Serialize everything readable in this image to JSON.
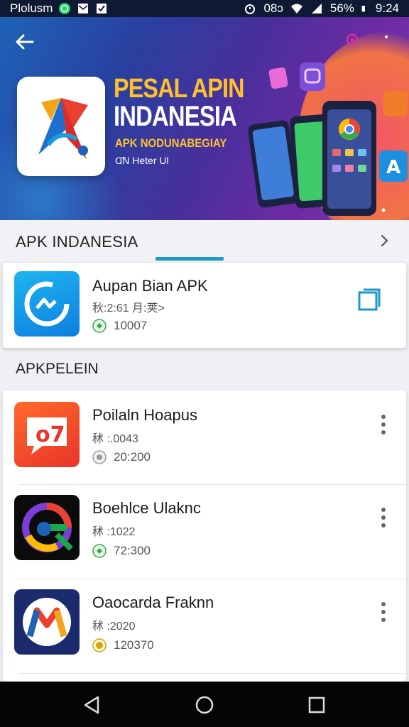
{
  "status": {
    "carrier": "Plolusm",
    "signal_text": "08ↄ",
    "battery": "56%",
    "time": "9:24"
  },
  "banner": {
    "title_line1": "PESAL APIN",
    "title_line2": "INDANESIA",
    "subtitle": "APK NODUNABEGIAY",
    "version": "Ɑ̃N Heter Ul"
  },
  "section1": {
    "title": "APK INDANESIA"
  },
  "featured": {
    "name": "Aupan Bian APK",
    "meta": "秋:2:61 月:荚>",
    "count": "10007"
  },
  "section2": {
    "title": "APKPELEIN"
  },
  "apps": [
    {
      "name": "Poilaln Hoapus",
      "meta": "秫 :.0043",
      "count": "20:200"
    },
    {
      "name": "Boehlce Ulaknc",
      "meta": "秫 :1022",
      "count": "72:300"
    },
    {
      "name": "Oaocarda Fraknn",
      "meta": "秫 :2020",
      "count": "120370"
    }
  ],
  "colors": {
    "accent": "#1e98c9",
    "banner_gold": "#ffc22e"
  }
}
